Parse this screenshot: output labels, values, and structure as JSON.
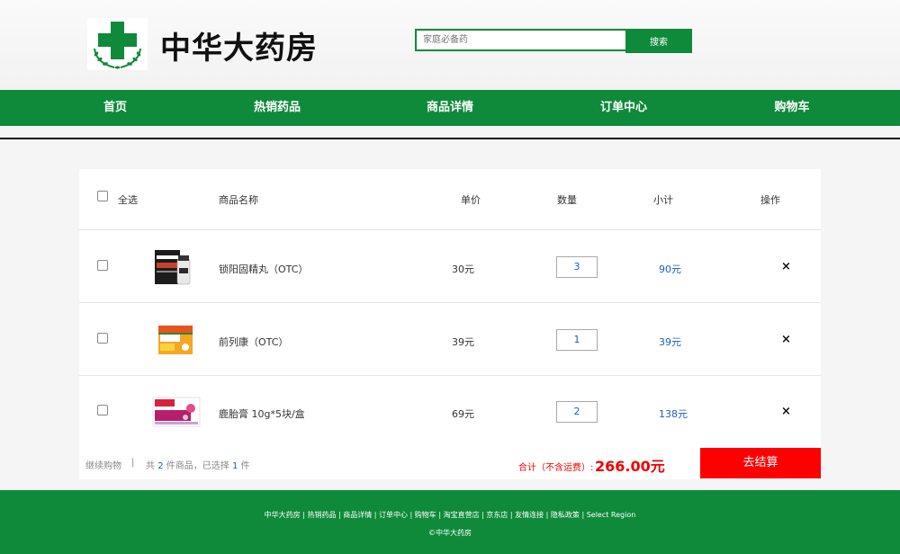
{
  "brand": {
    "name": "中华大药房",
    "accent": "#0e8a3a"
  },
  "search": {
    "placeholder": "家庭必备药",
    "button_label": "搜索"
  },
  "nav": {
    "items": [
      "首页",
      "热销药品",
      "商品详情",
      "订单中心",
      "购物车"
    ]
  },
  "cart": {
    "headers": {
      "select_all": "全选",
      "name": "商品名称",
      "price": "单价",
      "quantity": "数量",
      "subtotal": "小计",
      "action": "操作"
    },
    "items": [
      {
        "name": "锁阳固精丸（OTC）",
        "price": "30元",
        "quantity": "3",
        "subtotal": "90元",
        "remove": "×"
      },
      {
        "name": "前列康（OTC）",
        "price": "39元",
        "quantity": "1",
        "subtotal": "39元",
        "remove": "×"
      },
      {
        "name": "鹿胎膏 10g*5块/盒",
        "price": "69元",
        "quantity": "2",
        "subtotal": "138元",
        "remove": "×"
      }
    ],
    "footer": {
      "continue_label": "继续购物",
      "separator": "|",
      "count_prefix": "共",
      "total_count": "2",
      "count_middle": "件商品，已选择",
      "selected_count": "1",
      "count_suffix": "件",
      "total_label": "合计（不含运费）:",
      "total_value": "266.00元",
      "checkout_label": "去结算"
    }
  },
  "footer": {
    "links": "中华大药房 | 热销药品 | 商品详情 | 订单中心 | 购物车 | 淘宝直营店 | 京东店 | 友情连接 | 隐私政策 | Select Region",
    "copyright": "©中华大药房"
  }
}
